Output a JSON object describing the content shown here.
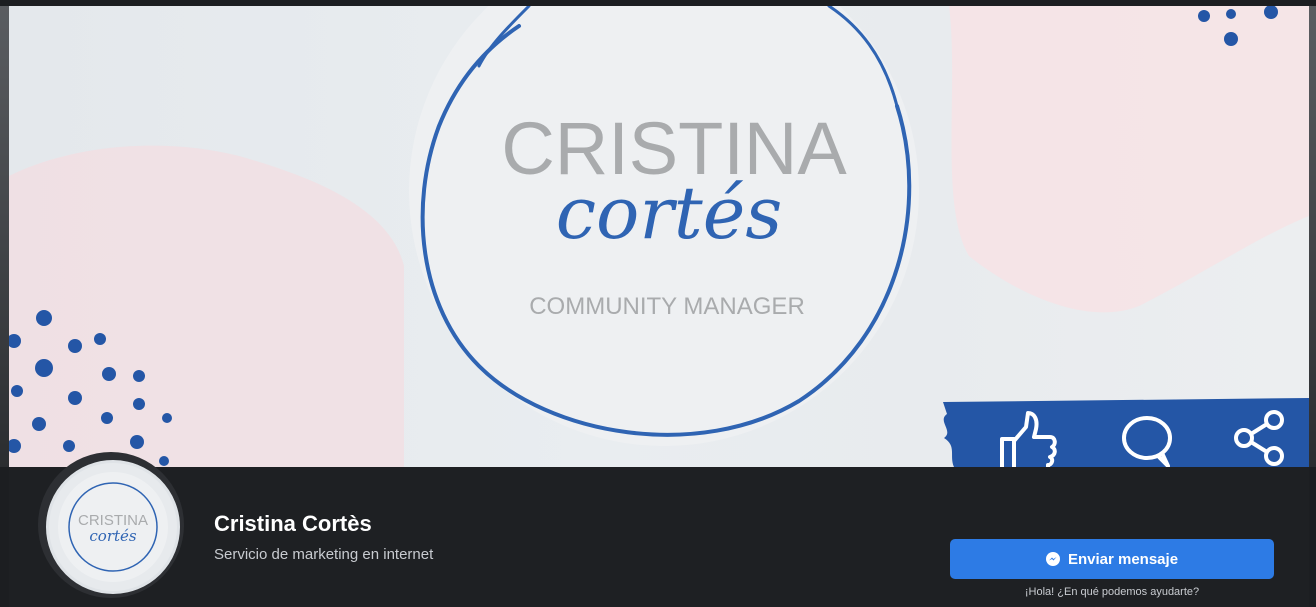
{
  "cover": {
    "brand_title": "CRISTINA",
    "brand_script": "cortés",
    "brand_subtitle": "COMMUNITY MANAGER"
  },
  "avatar": {
    "brand_title": "CRISTINA",
    "brand_script": "cortés"
  },
  "page": {
    "name": "Cristina Cortès",
    "category": "Servicio de marketing en internet"
  },
  "actions": {
    "send_message_label": "Enviar mensaje",
    "send_message_icon": "messenger-icon",
    "helper_text": "¡Hola! ¿En qué podemos ayudarte?"
  },
  "social_icons": [
    "like-icon",
    "comment-icon",
    "share-icon"
  ],
  "colors": {
    "brand_blue": "#2f64b3",
    "button_blue": "#2d7be5",
    "pink_accent": "#f7d8dd",
    "dark_bg": "#1e2023"
  }
}
